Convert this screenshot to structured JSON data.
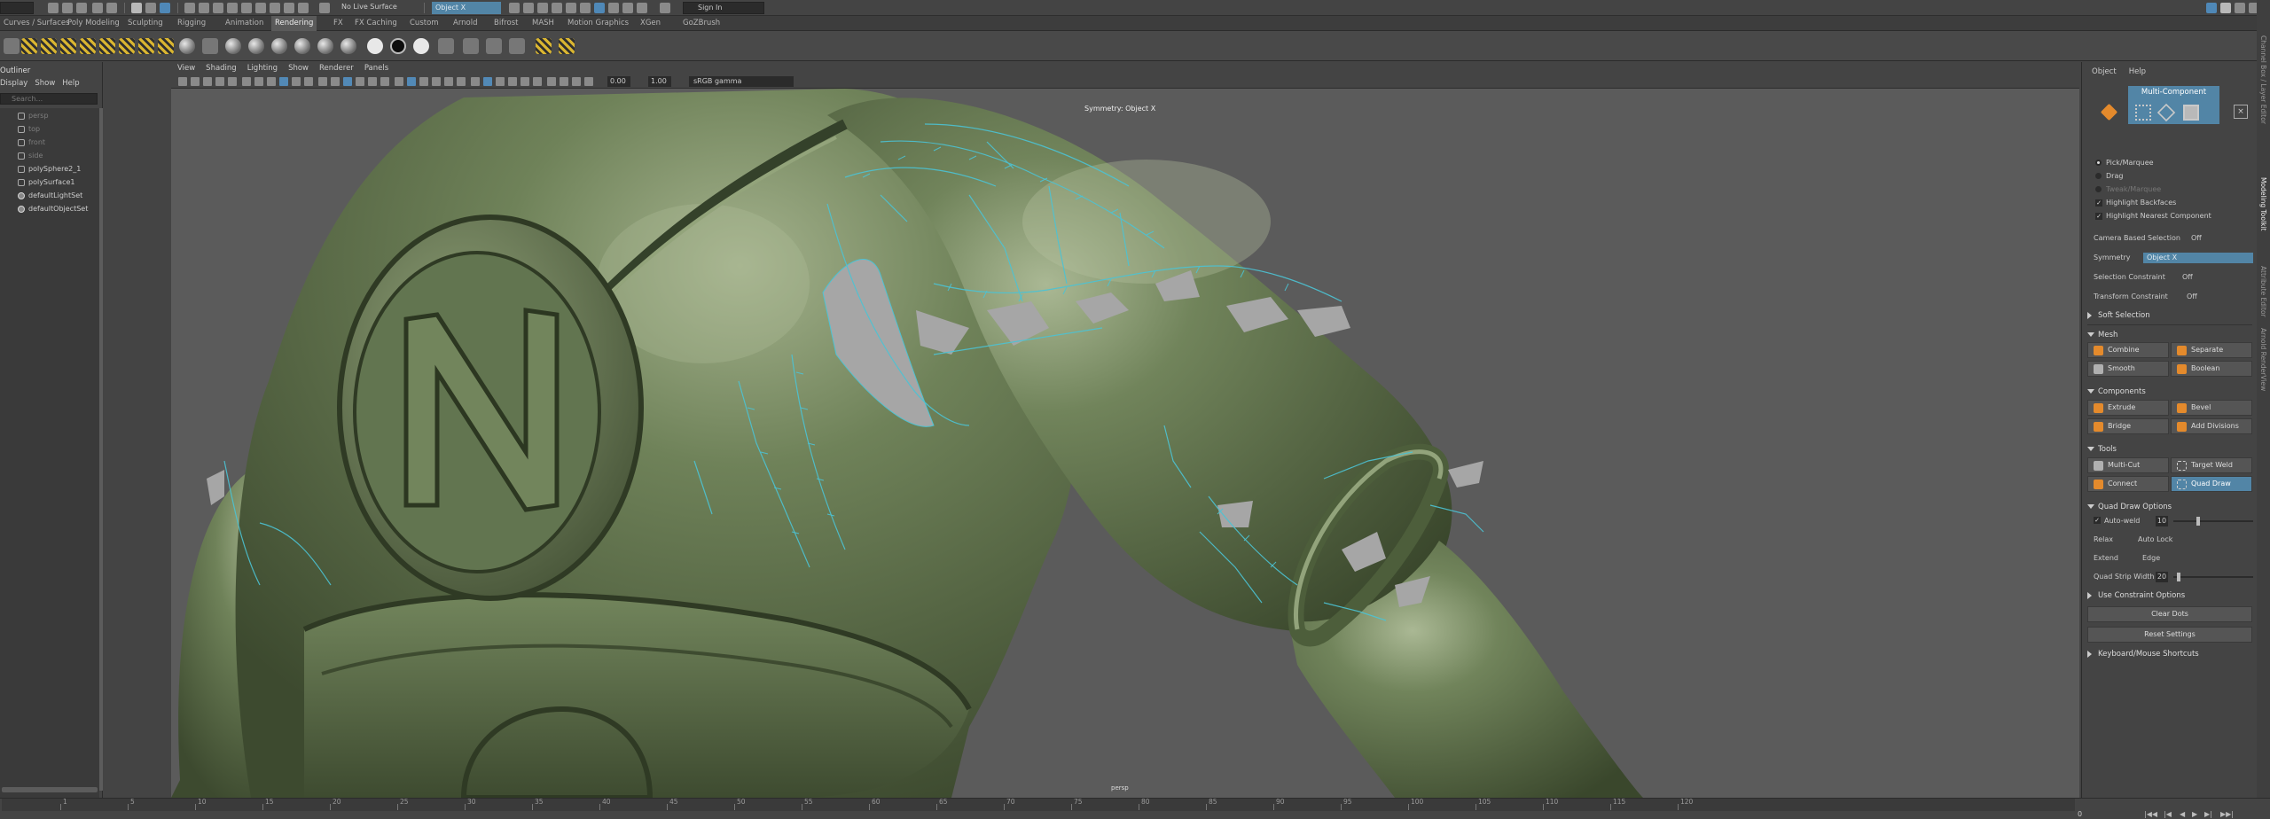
{
  "status_line": {
    "mode": "",
    "live_surface": "No Live Surface",
    "object_field": "Object X",
    "sign_in": "Sign In"
  },
  "shelf_tabs": [
    {
      "label": "Curves / Surfaces",
      "active": false
    },
    {
      "label": "Poly Modeling",
      "active": false
    },
    {
      "label": "Sculpting",
      "active": false
    },
    {
      "label": "Rigging",
      "active": false
    },
    {
      "label": "Animation",
      "active": false
    },
    {
      "label": "Rendering",
      "active": true
    },
    {
      "label": "FX",
      "active": false
    },
    {
      "label": "FX Caching",
      "active": false
    },
    {
      "label": "Custom",
      "active": false
    },
    {
      "label": "Arnold",
      "active": false
    },
    {
      "label": "Bifrost",
      "active": false
    },
    {
      "label": "MASH",
      "active": false
    },
    {
      "label": "Motion Graphics",
      "active": false
    },
    {
      "label": "XGen",
      "active": false
    },
    {
      "label": "GoZBrush",
      "active": false
    }
  ],
  "outliner": {
    "title": "Outliner",
    "menu": [
      "Display",
      "Show",
      "Help"
    ],
    "search_placeholder": "Search...",
    "items": [
      {
        "label": "persp",
        "dim": true,
        "kind": "cam"
      },
      {
        "label": "top",
        "dim": true,
        "kind": "cam"
      },
      {
        "label": "front",
        "dim": true,
        "kind": "cam"
      },
      {
        "label": "side",
        "dim": true,
        "kind": "cam"
      },
      {
        "label": "polySphere2_1",
        "dim": false,
        "kind": "mesh"
      },
      {
        "label": "polySurface1",
        "dim": false,
        "kind": "mesh"
      },
      {
        "label": "defaultLightSet",
        "dim": false,
        "kind": "set"
      },
      {
        "label": "defaultObjectSet",
        "dim": false,
        "kind": "set"
      }
    ]
  },
  "viewport": {
    "menu": [
      "View",
      "Shading",
      "Lighting",
      "Show",
      "Renderer",
      "Panels"
    ],
    "field_1": "0.00",
    "field_2": "1.00",
    "color_space": "sRGB gamma",
    "symmetry_label": "Symmetry: Object X",
    "camera_label": "persp"
  },
  "toolkit": {
    "menu": [
      "Object",
      "Help"
    ],
    "multi_component": "Multi-Component",
    "selection_options": [
      {
        "label": "Pick/Marquee",
        "type": "radio",
        "on": true,
        "dim": false
      },
      {
        "label": "Drag",
        "type": "radio",
        "on": false,
        "dim": false
      },
      {
        "label": "Tweak/Marquee",
        "type": "radio",
        "on": false,
        "dim": true
      },
      {
        "label": "Highlight Backfaces",
        "type": "check",
        "on": true,
        "dim": false
      },
      {
        "label": "Highlight Nearest Component",
        "type": "check",
        "on": true,
        "dim": false
      }
    ],
    "camera_based_selection": {
      "label": "Camera Based Selection",
      "value": "Off"
    },
    "symmetry": {
      "label": "Symmetry",
      "value": "Object X"
    },
    "selection_constraint": {
      "label": "Selection Constraint",
      "value": "Off"
    },
    "transform_constraint": {
      "label": "Transform Constraint",
      "value": "Off"
    },
    "soft_selection": "Soft Selection",
    "mesh_section": "Mesh",
    "mesh_buttons": [
      "Combine",
      "Separate",
      "Smooth",
      "Boolean"
    ],
    "components_section": "Components",
    "component_buttons": [
      "Extrude",
      "Bevel",
      "Bridge",
      "Add Divisions"
    ],
    "tools_section": "Tools",
    "tool_buttons": [
      "Multi-Cut",
      "Target Weld",
      "Connect",
      "Quad Draw"
    ],
    "quad_draw_options": "Quad Draw Options",
    "auto_weld": {
      "label": "Auto-weld",
      "value": "10",
      "level": 0.3
    },
    "relax": {
      "label": "Relax",
      "value": "Auto Lock"
    },
    "extend": {
      "label": "Extend",
      "value": "Edge"
    },
    "quad_strip_width": {
      "label": "Quad Strip Width",
      "value": "20",
      "level": 0.05
    },
    "use_constraint_options": "Use Constraint Options",
    "clear_dots": "Clear Dots",
    "reset_settings": "Reset Settings",
    "shortcuts": "Keyboard/Mouse Shortcuts"
  },
  "right_tabs": [
    {
      "label": "Channel Box / Layer Editor",
      "active": false
    },
    {
      "label": "Modeling Toolkit",
      "active": true
    },
    {
      "label": "Attribute Editor",
      "active": false
    },
    {
      "label": "Arnold RenderView",
      "active": false
    }
  ],
  "timeline": {
    "ticks": [
      "1",
      "5",
      "10",
      "15",
      "20",
      "25",
      "30",
      "35",
      "40",
      "45",
      "50",
      "55",
      "60",
      "65",
      "70",
      "75",
      "80",
      "85",
      "90",
      "95",
      "100",
      "105",
      "110",
      "115",
      "120"
    ],
    "current_frame": "0"
  },
  "colors": {
    "accent": "#5285a6",
    "body": "#5c7049",
    "wire": "#4cc3d4",
    "icon_orange": "#e48a2c"
  }
}
